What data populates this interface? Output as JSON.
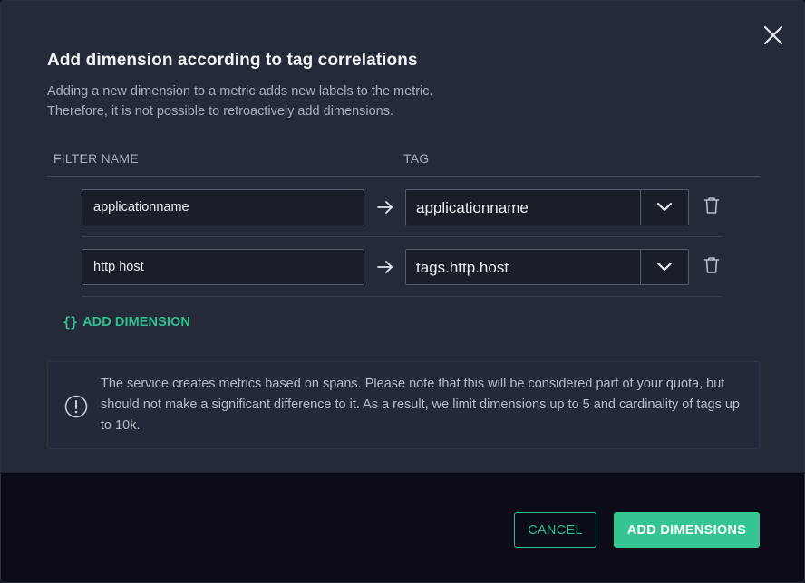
{
  "dialog": {
    "title": "Add dimension according to tag correlations",
    "description_line1": "Adding a new dimension to a metric adds new labels to the metric.",
    "description_line2": "Therefore, it is not possible to retroactively add dimensions."
  },
  "columns": {
    "filter_name": "FILTER NAME",
    "tag": "TAG"
  },
  "dimensions": [
    {
      "filter_name": "applicationname",
      "tag": "applicationname"
    },
    {
      "filter_name": "http host",
      "tag": "tags.http.host"
    }
  ],
  "add_dimension": {
    "icon": "braces-icon",
    "icon_glyph": "{}",
    "label": "ADD DIMENSION"
  },
  "notice": {
    "icon": "info-icon",
    "text": "The service creates metrics based on spans. Please note that this will be considered part of your quota, but should not make a significant difference to it. As a result, we limit dimensions up to 5 and cardinality of tags up to 10k."
  },
  "footer": {
    "cancel_label": "CANCEL",
    "submit_label": "ADD DIMENSIONS"
  },
  "colors": {
    "accent": "#35c592",
    "panel": "#252a38",
    "backdrop": "#0b0c18"
  }
}
